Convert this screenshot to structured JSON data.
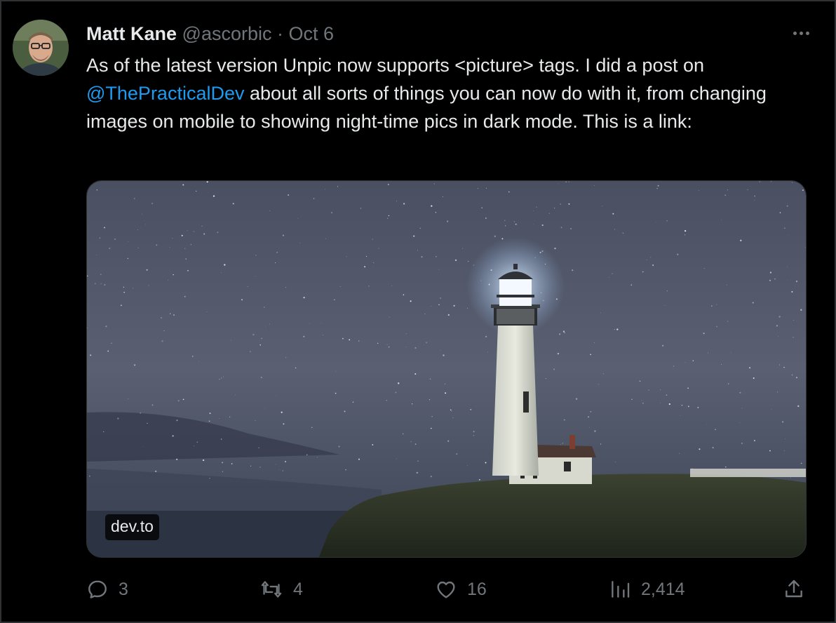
{
  "author": {
    "name": "Matt Kane",
    "handle": "@ascorbic",
    "separator": "·",
    "date": "Oct 6"
  },
  "tweet": {
    "text_part1": "As of the latest version Unpic now supports <picture> tags. I did a post on ",
    "mention": "@ThePracticalDev",
    "text_part2": " about all sorts of things you can now do with it, from changing images on mobile to showing night-time pics in dark mode. This is a link:"
  },
  "card": {
    "domain": "dev.to",
    "image_icon": "lighthouse-night-photo"
  },
  "actions": {
    "replies": "3",
    "retweets": "4",
    "likes": "16",
    "views": "2,414"
  },
  "icons": {
    "reply": "reply-icon",
    "retweet": "retweet-icon",
    "like": "heart-icon",
    "views": "views-icon",
    "share": "share-icon",
    "more": "more-icon"
  },
  "colors": {
    "background": "#000000",
    "text": "#e7e9ea",
    "secondary": "#71767b",
    "accent": "#1d9bf0"
  }
}
